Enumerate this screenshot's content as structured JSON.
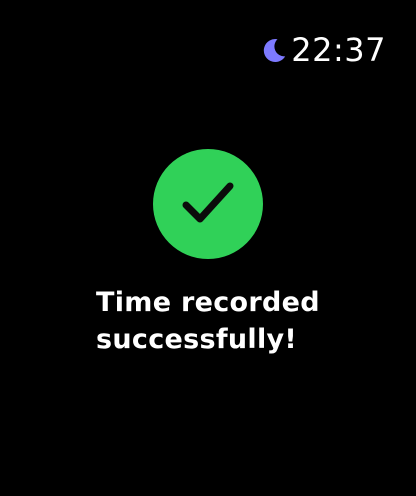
{
  "status": {
    "time": "22:37",
    "focus_icon": "moon-icon",
    "focus_color": "#7d7aff"
  },
  "confirmation": {
    "icon": "checkmark-icon",
    "badge_color": "#30d158",
    "message_line1": "Time recorded",
    "message_line2": "successfully!"
  }
}
